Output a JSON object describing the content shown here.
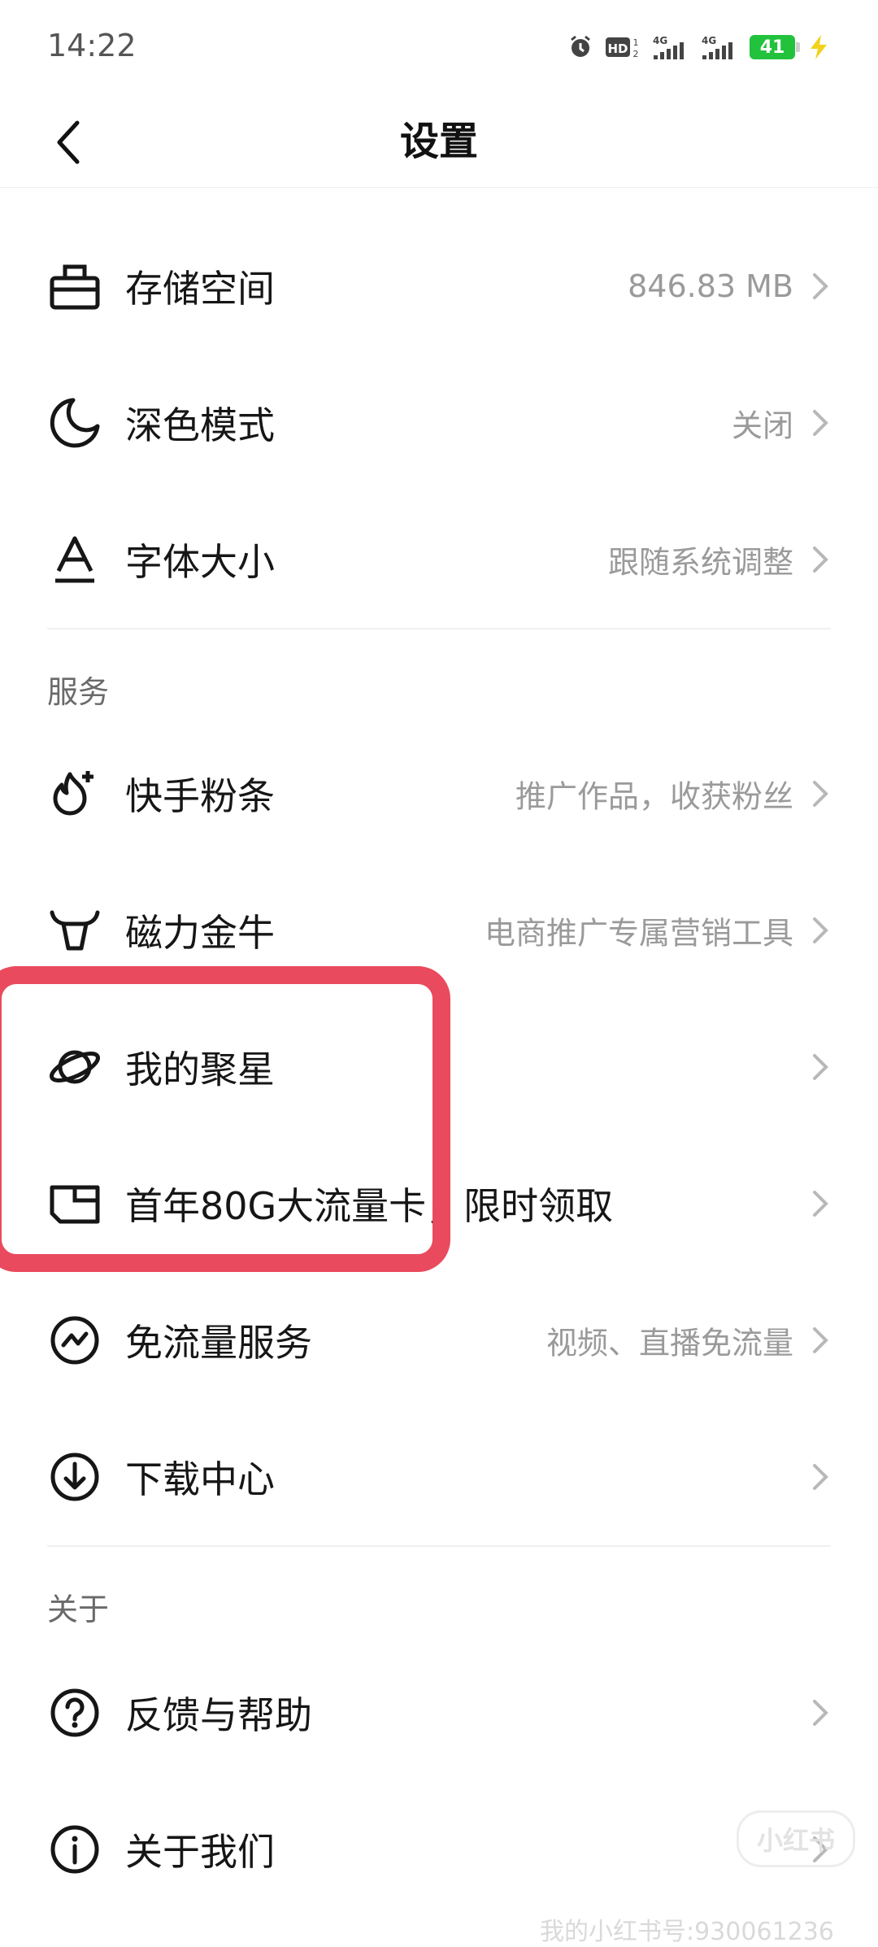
{
  "status_bar": {
    "time": "14:22",
    "icons": [
      "alarm-icon",
      "hd-icon",
      "signal-4g-icon",
      "signal-4g-icon",
      "battery-icon",
      "charging-icon"
    ],
    "battery_level": "41",
    "colors": {
      "battery": "#22c23d",
      "charging": "#f2d21c"
    }
  },
  "header": {
    "title": "设置",
    "back_icon": "chevron-left-icon"
  },
  "general": {
    "items": [
      {
        "icon": "storage-box-icon",
        "label": "存储空间",
        "value": "846.83 MB"
      },
      {
        "icon": "moon-icon",
        "label": "深色模式",
        "value": "关闭"
      },
      {
        "icon": "font-size-icon",
        "label": "字体大小",
        "value": "跟随系统调整"
      }
    ]
  },
  "services": {
    "title": "服务",
    "items": [
      {
        "icon": "fire-plus-icon",
        "label": "快手粉条",
        "value": "推广作品，收获粉丝"
      },
      {
        "icon": "bull-icon",
        "label": "磁力金牛",
        "value": "电商推广专属营销工具"
      },
      {
        "icon": "planet-icon",
        "label": "我的聚星",
        "value": ""
      },
      {
        "icon": "sim-card-icon",
        "label": "首年80G大流量卡，限时领取",
        "value": ""
      },
      {
        "icon": "free-data-icon",
        "label": "免流量服务",
        "value": "视频、直播免流量"
      },
      {
        "icon": "download-icon",
        "label": "下载中心",
        "value": ""
      }
    ]
  },
  "about": {
    "title": "关于",
    "items": [
      {
        "icon": "question-circle-icon",
        "label": "反馈与帮助",
        "value": ""
      },
      {
        "icon": "info-circle-icon",
        "label": "关于我们",
        "value": ""
      }
    ]
  },
  "highlight_color": "#ea4a5d",
  "watermark": {
    "logo_text": "小红书",
    "text": "我的小红书号:930061236"
  }
}
